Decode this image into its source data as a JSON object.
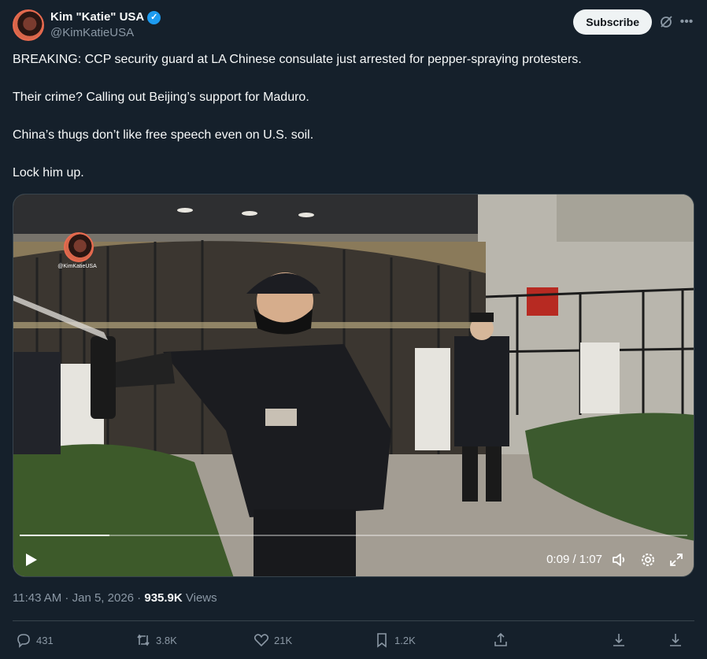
{
  "author": {
    "display_name": "Kim \"Katie\" USA",
    "handle": "@KimKatieUSA",
    "verified_icon": "verified-badge-icon",
    "avatar_icon": "avatar"
  },
  "header": {
    "subscribe_label": "Subscribe",
    "grok_icon": "grok-icon",
    "more_icon": "more-icon"
  },
  "tweet": {
    "paragraphs": [
      "BREAKING: CCP security guard at LA Chinese consulate just arrested for pepper-spraying protesters.",
      "Their crime? Calling out Beijing’s support for Maduro.",
      "China’s thugs don’t like free speech even on U.S. soil.",
      "Lock him up."
    ]
  },
  "video": {
    "watermark_text": "@KimKatieUSA",
    "time_display": "0:09 / 1:07",
    "progress": 0.134,
    "icons": [
      "play-icon",
      "volume-icon",
      "settings-icon",
      "fullscreen-icon"
    ]
  },
  "meta": {
    "time": "11:43 AM",
    "separator": " · ",
    "date": "Jan 5, 2026",
    "views_count": "935.9K",
    "views_label": " Views"
  },
  "actions": {
    "reply_count": "431",
    "retweet_count": "3.8K",
    "like_count": "21K",
    "bookmark_count": "1.2K"
  },
  "colors": {
    "background": "#15202b",
    "text": "#f7f9f9",
    "muted": "#8b98a5",
    "accent": "#1d9bf0",
    "border": "#38444d"
  }
}
